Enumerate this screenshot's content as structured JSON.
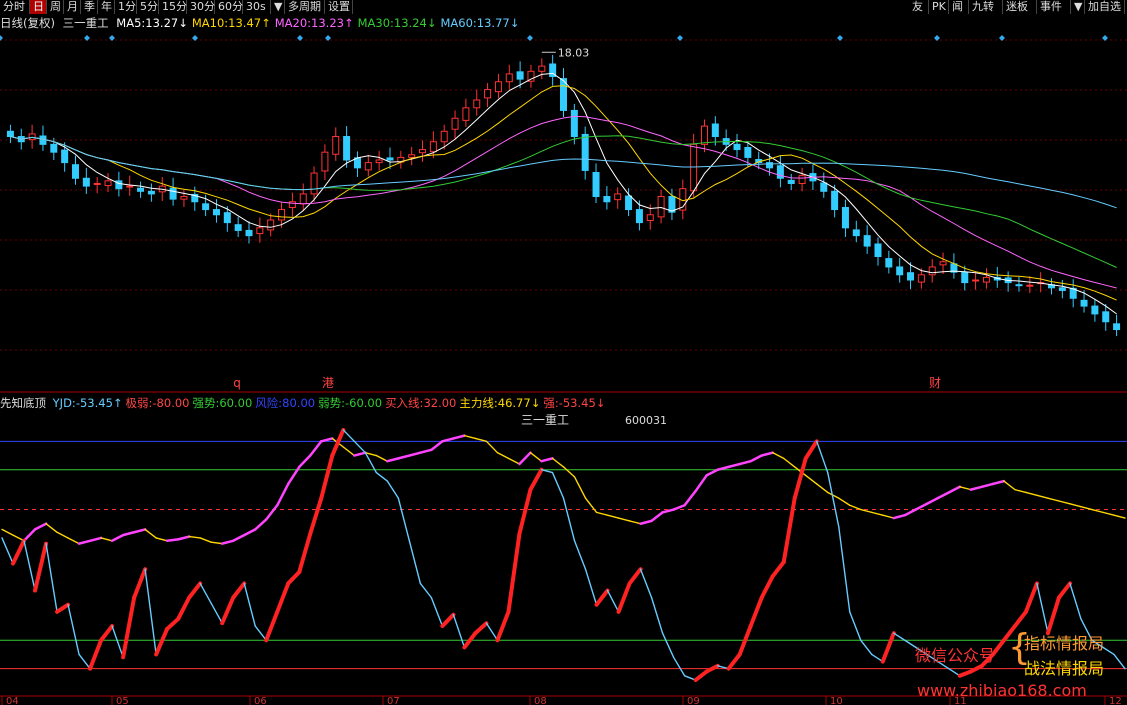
{
  "toolbar": {
    "left_items": [
      "分时",
      "日",
      "周",
      "月",
      "季",
      "年",
      "1分",
      "5分",
      "15分",
      "30分",
      "60分",
      "30s",
      "▼",
      "多周期",
      "设置"
    ],
    "active": "日",
    "right_items": [
      "友",
      "PK",
      "闻",
      "九转",
      "迷板",
      "事件",
      "▼",
      "加自选"
    ]
  },
  "main_header": {
    "period_label": "日线(复权)",
    "stock_name": "三一重工",
    "ma": [
      {
        "label": "MA5:",
        "value": "13.27",
        "arrow": "↓",
        "color": "#ffffff"
      },
      {
        "label": "MA10:",
        "value": "13.47",
        "arrow": "↑",
        "color": "#ffd700"
      },
      {
        "label": "MA20:",
        "value": "13.23",
        "arrow": "↑",
        "color": "#ff66ff"
      },
      {
        "label": "MA30:",
        "value": "13.24",
        "arrow": "↓",
        "color": "#33cc33"
      },
      {
        "label": "MA60:",
        "value": "13.77",
        "arrow": "↓",
        "color": "#66ccff"
      }
    ]
  },
  "price_annotation": "18.03",
  "event_markers": [
    "q",
    "港",
    "财"
  ],
  "indicator_header": {
    "name": "先知底顶",
    "items": [
      {
        "label": "YJD:",
        "value": "-53.45",
        "arrow": "↑",
        "color": "#66ccff"
      },
      {
        "label": "极弱:",
        "value": "-80.00",
        "arrow": "",
        "color": "#ff4444"
      },
      {
        "label": "强势:",
        "value": "60.00",
        "arrow": "",
        "color": "#33cc33"
      },
      {
        "label": "风险:",
        "value": "80.00",
        "arrow": "",
        "color": "#3344ff"
      },
      {
        "label": "弱势:",
        "value": "-60.00",
        "arrow": "",
        "color": "#33cc33"
      },
      {
        "label": "买入线:",
        "value": "32.00",
        "arrow": "",
        "color": "#ff4444"
      },
      {
        "label": "主力线:",
        "value": "46.77",
        "arrow": "↓",
        "color": "#ffd700"
      },
      {
        "label": "强:",
        "value": "-53.45",
        "arrow": "↓",
        "color": "#ff4444"
      }
    ]
  },
  "indicator_title": "三一重工",
  "indicator_code": "600031",
  "x_axis_labels": [
    "04",
    "05",
    "06",
    "07",
    "08",
    "09",
    "10",
    "11",
    "12"
  ],
  "watermark": {
    "wechat": "微信公众号",
    "line1": "指标情报局",
    "line2": "战法情报局",
    "url": "www.zhibiao168.com"
  },
  "colors": {
    "up": "#ff3333",
    "down": "#33ccff",
    "ma5": "#ffffff",
    "ma10": "#ffd700",
    "ma20": "#ff66ff",
    "ma30": "#33cc33",
    "ma60": "#66ccff",
    "risk": "#3344ff",
    "strong": "#33cc33",
    "buy": "#ff3333",
    "weak": "#33cc33",
    "extreme": "#ff3333"
  },
  "chart_data": {
    "type": "line",
    "price_series": {
      "name": "日线(复权)",
      "close": [
        14.8,
        14.6,
        14.9,
        14.5,
        14.2,
        13.8,
        13.2,
        12.9,
        13.0,
        13.1,
        12.8,
        12.9,
        12.7,
        12.6,
        12.9,
        12.4,
        12.5,
        12.3,
        12.0,
        11.8,
        11.5,
        11.2,
        11.0,
        11.3,
        11.6,
        12.0,
        12.3,
        12.6,
        13.4,
        14.2,
        14.8,
        13.9,
        13.6,
        13.8,
        13.9,
        13.9,
        14.0,
        14.1,
        14.3,
        14.6,
        15.0,
        15.5,
        15.9,
        16.2,
        16.6,
        16.9,
        17.2,
        17.0,
        17.3,
        17.5,
        17.1,
        15.8,
        14.8,
        13.5,
        12.5,
        12.3,
        12.6,
        12.0,
        11.5,
        11.8,
        12.5,
        11.9,
        12.8,
        14.5,
        15.2,
        14.8,
        14.5,
        14.3,
        14.0,
        13.8,
        13.6,
        13.2,
        13.0,
        13.3,
        13.1,
        12.7,
        12.0,
        11.3,
        11.0,
        10.6,
        10.2,
        9.8,
        9.5,
        9.3,
        9.5,
        9.8,
        10.0,
        9.6,
        9.2,
        9.3,
        9.4,
        9.3,
        9.2,
        9.1,
        9.1,
        9.2,
        9.0,
        8.9,
        8.6,
        8.3,
        8.0,
        7.7,
        7.4
      ],
      "high_mark": 18.03
    },
    "indicator_series": [
      {
        "name": "YJD",
        "values": [
          12,
          -6,
          10,
          -25,
          8,
          -40,
          -35,
          -70,
          -80,
          -60,
          -50,
          -72,
          -30,
          -10,
          -70,
          -52,
          -45,
          -30,
          -20,
          -34,
          -48,
          -30,
          -20,
          -50,
          -60,
          -40,
          -20,
          -12,
          15,
          40,
          70,
          88,
          80,
          72,
          58,
          52,
          40,
          10,
          -20,
          -30,
          -50,
          -42,
          -65,
          -55,
          -48,
          -60,
          -40,
          15,
          46,
          60,
          58,
          40,
          10,
          -10,
          -35,
          -25,
          -40,
          -20,
          -10,
          -30,
          -55,
          -72,
          -85,
          -88,
          -82,
          -78,
          -80,
          -70,
          -50,
          -30,
          -15,
          -5,
          40,
          68,
          80,
          58,
          20,
          -40,
          -60,
          -70,
          -75,
          -55,
          -60,
          -65,
          -70,
          -75,
          -80,
          -85,
          -82,
          -78,
          -70,
          -60,
          -50,
          -40,
          -20,
          -55,
          -30,
          -20,
          -45,
          -60,
          -65,
          -70,
          -80
        ],
        "color": "#66ccff"
      },
      {
        "name": "主力线",
        "values": [
          18,
          14,
          10,
          18,
          22,
          16,
          12,
          8,
          10,
          12,
          10,
          14,
          16,
          18,
          12,
          10,
          11,
          13,
          12,
          9,
          8,
          10,
          14,
          18,
          25,
          35,
          50,
          62,
          70,
          80,
          82,
          76,
          70,
          72,
          70,
          66,
          68,
          70,
          72,
          74,
          80,
          82,
          84,
          82,
          80,
          72,
          68,
          64,
          72,
          66,
          68,
          62,
          55,
          40,
          30,
          28,
          26,
          24,
          22,
          24,
          30,
          32,
          35,
          45,
          56,
          60,
          62,
          64,
          66,
          70,
          72,
          68,
          62,
          56,
          50,
          44,
          40,
          35,
          32,
          30,
          28,
          26,
          28,
          32,
          36,
          40,
          44,
          48,
          46,
          48,
          50,
          52,
          46,
          44,
          42,
          40,
          38,
          36,
          34,
          32,
          30,
          28,
          26
        ],
        "color": "#ffd700"
      }
    ],
    "reference_lines": [
      {
        "name": "风险",
        "y": 80
      },
      {
        "name": "强势",
        "y": 60
      },
      {
        "name": "买入线",
        "y": 32
      },
      {
        "name": "弱势",
        "y": -60
      },
      {
        "name": "极弱",
        "y": -80
      }
    ],
    "x_ticks": [
      "04",
      "05",
      "06",
      "07",
      "08",
      "09",
      "10",
      "11",
      "12"
    ]
  }
}
